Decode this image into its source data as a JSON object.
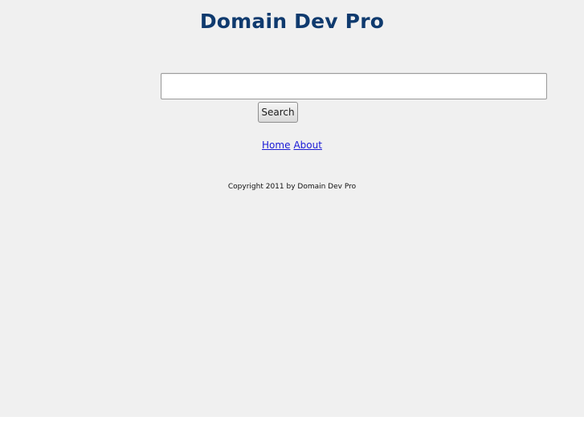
{
  "header": {
    "title": "Domain Dev Pro"
  },
  "search": {
    "value": "",
    "placeholder": "",
    "button_label": "Search"
  },
  "nav": {
    "items": [
      {
        "label": "Home"
      },
      {
        "label": "About"
      }
    ]
  },
  "footer": {
    "copyright": "Copyright 2011 by Domain Dev Pro"
  },
  "colors": {
    "background": "#f0f0f0",
    "title": "#0f3a6e",
    "link": "#1a1ad6"
  }
}
